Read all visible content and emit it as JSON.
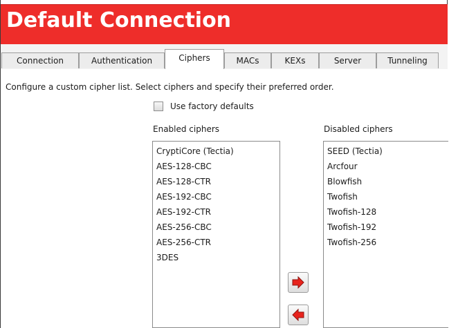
{
  "window": {
    "title": "Default Connection"
  },
  "tabs": [
    {
      "label": "Connection"
    },
    {
      "label": "Authentication"
    },
    {
      "label": "Ciphers",
      "active": true
    },
    {
      "label": "MACs"
    },
    {
      "label": "KEXs"
    },
    {
      "label": "Server"
    },
    {
      "label": "Tunneling"
    }
  ],
  "ciphers_page": {
    "description": "Configure a custom cipher list. Select ciphers and specify their preferred order.",
    "factory_defaults_label": "Use factory defaults",
    "factory_defaults_checked": false,
    "enabled_label": "Enabled ciphers",
    "disabled_label": "Disabled ciphers",
    "enabled": [
      "CryptiCore (Tectia)",
      "AES-128-CBC",
      "AES-128-CTR",
      "AES-192-CBC",
      "AES-192-CTR",
      "AES-256-CBC",
      "AES-256-CTR",
      "3DES"
    ],
    "disabled": [
      "SEED (Tectia)",
      "Arcfour",
      "Blowfish",
      "Twofish",
      "Twofish-128",
      "Twofish-192",
      "Twofish-256"
    ]
  },
  "buttons": {
    "move_right_icon": "arrow-right-icon",
    "move_left_icon": "arrow-left-icon"
  },
  "colors": {
    "title_bar": "#ee2d2a",
    "title_text": "#ffffff",
    "arrow": "#e8231d"
  }
}
